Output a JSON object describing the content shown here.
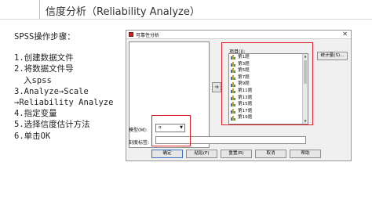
{
  "slide": {
    "title": "信度分析（Reliability Analyze）",
    "steps_heading": "SPSS操作步骤：",
    "steps": [
      "1.创建数据文件",
      "2.将数据文件导",
      "  入spss",
      "3.Analyze→Scale",
      "→Reliability Analyze",
      "4.指定变量",
      "5.选择信度估计方法",
      "6.单击OK"
    ]
  },
  "dialog": {
    "title": "可靠性分析",
    "close_glyph": "✕",
    "move_glyph": "➜",
    "items_label": "项目(I):",
    "items": [
      "第1题",
      "第3题",
      "第5题",
      "第7题",
      "第9题",
      "第11题",
      "第13题",
      "第15题",
      "第17题",
      "第19题"
    ],
    "statistics_button": "统计量(S)...",
    "model_label": "模型(M):",
    "model_value": "α",
    "scale_label": "刻度标签:",
    "scale_value": "",
    "buttons": {
      "ok": "确定",
      "paste": "粘贴(P)",
      "reset": "重置(R)",
      "cancel": "取消",
      "help": "帮助"
    }
  },
  "colors": {
    "highlight": "#e0202a",
    "dialog_bg": "#f0f0f0"
  }
}
